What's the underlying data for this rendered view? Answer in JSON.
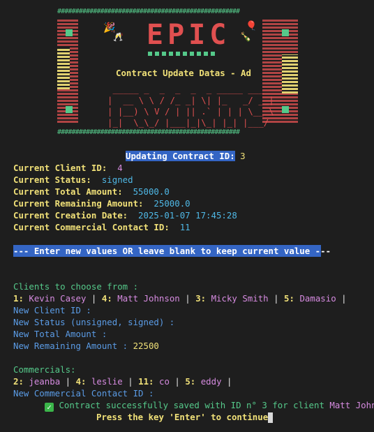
{
  "banner": {
    "logo_text": "EPIC",
    "subtitle": "Contract Update Datas - Ad"
  },
  "header": {
    "updating_label": "Updating Contract ID:",
    "updating_value": "3"
  },
  "current": [
    {
      "label": "Current Client ID:",
      "value": "4"
    },
    {
      "label": "Current Status:",
      "value": "signed"
    },
    {
      "label": "Current Total Amount:",
      "value": "55000.0"
    },
    {
      "label": "Current Remaining Amount:",
      "value": "25000.0"
    },
    {
      "label": "Current Creation Date:",
      "value": "2025-01-07 17:45:28"
    },
    {
      "label": "Current Commercial Contact ID:",
      "value": "11"
    }
  ],
  "instruction": "--- Enter new values OR leave blank to keep current value ---",
  "clients": {
    "heading": "Clients to choose from :",
    "items": [
      {
        "id": "1:",
        "name": "Kevin Casey"
      },
      {
        "id": "4:",
        "name": "Matt Johnson"
      },
      {
        "id": "3:",
        "name": "Micky Smith"
      },
      {
        "id": "5:",
        "name": "Damasio"
      }
    ]
  },
  "prompts": {
    "client_id": "New Client ID :",
    "status": "New Status (unsigned, signed) :",
    "total": "New Total Amount :",
    "remaining": "New Remaining Amount :",
    "remaining_value": "22500",
    "commercial": "New Commercial Contact ID :"
  },
  "commercials": {
    "heading": "Commercials:",
    "items": [
      {
        "id": "2:",
        "name": "jeanba"
      },
      {
        "id": "4:",
        "name": "leslie"
      },
      {
        "id": "11:",
        "name": "co"
      },
      {
        "id": "5:",
        "name": "eddy"
      }
    ]
  },
  "result": {
    "check_icon": "white-check-mark",
    "message": "Contract successfully saved with ID n° 3 for client",
    "client": "Matt Johnson"
  },
  "continue_text": "Press the key 'Enter' to continue",
  "colors": {
    "background": "#1e1e1e",
    "yellow": "#f0e078",
    "pink": "#d68be0",
    "cyan": "#4fb8e6",
    "green": "#55c98a",
    "red": "#e05050",
    "highlight": "#3465c4"
  }
}
